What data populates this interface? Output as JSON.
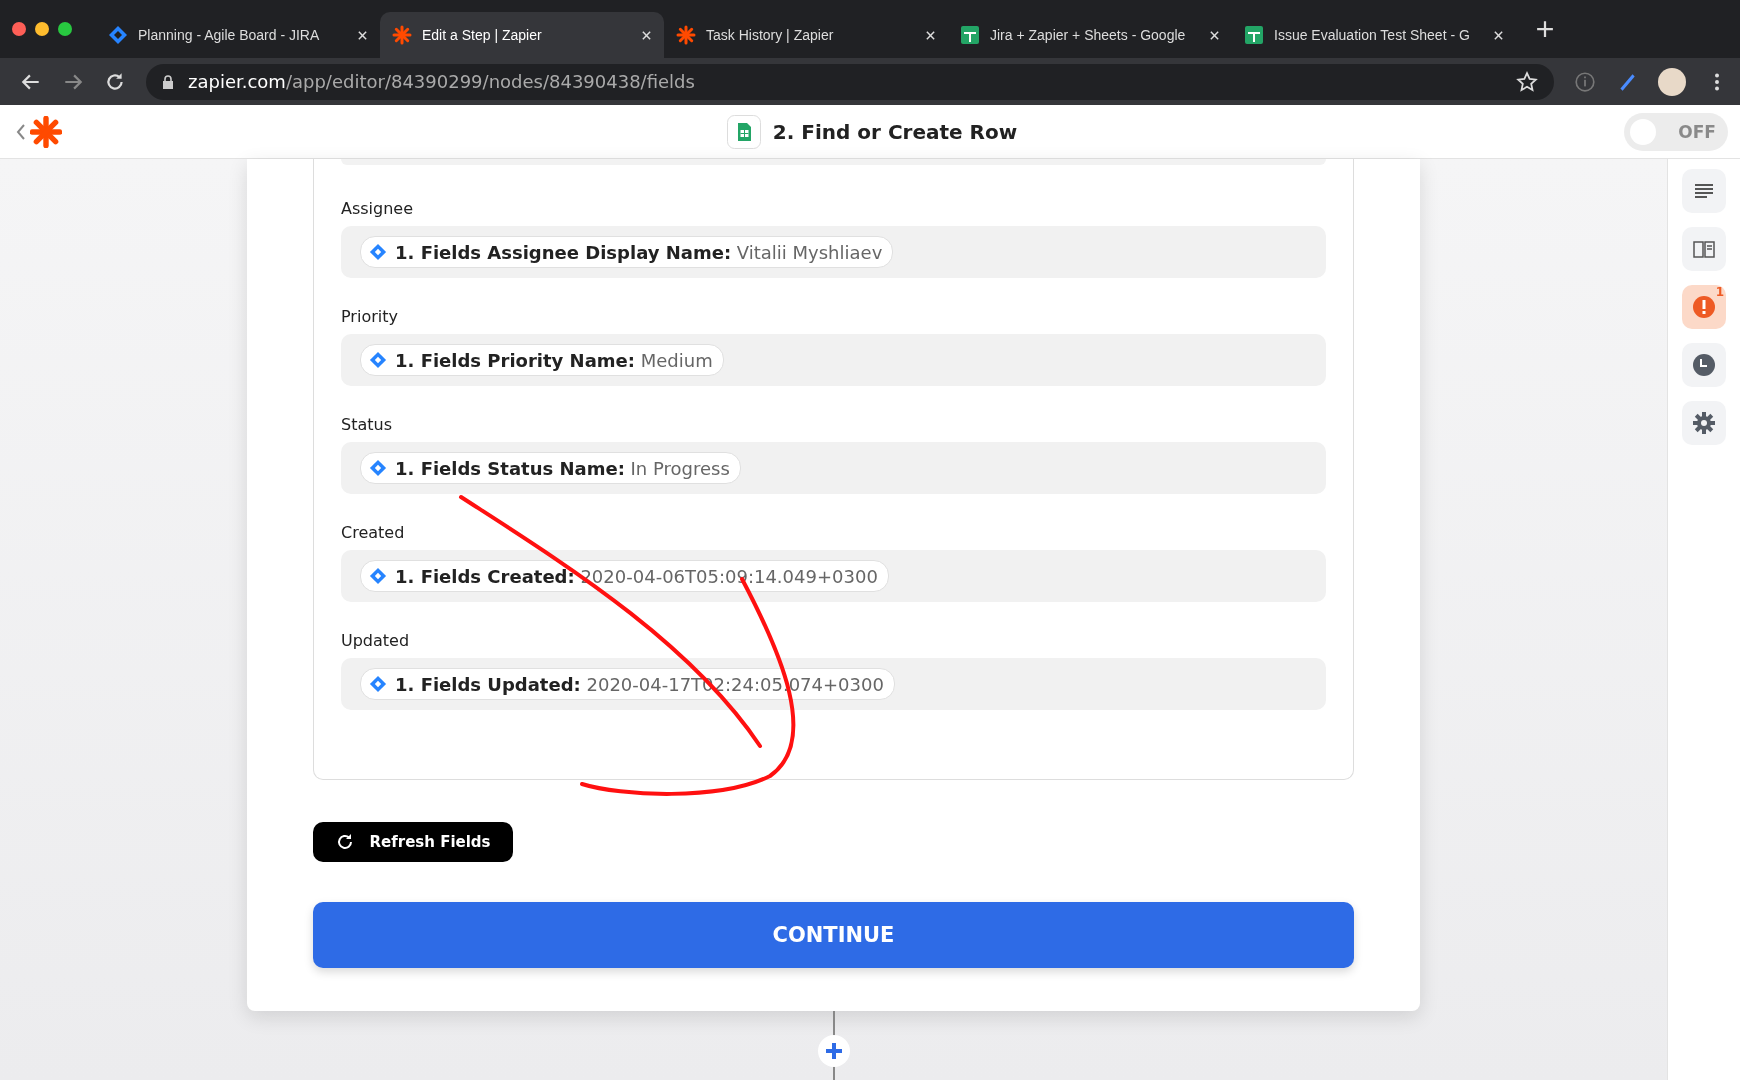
{
  "browser": {
    "tabs": [
      {
        "kind": "jira",
        "title": "Planning - Agile Board - JIRA",
        "selected": false
      },
      {
        "kind": "zapier",
        "title": "Edit a Step | Zapier",
        "selected": true
      },
      {
        "kind": "zapier",
        "title": "Task History | Zapier",
        "selected": false
      },
      {
        "kind": "sheets",
        "title": "Jira + Zapier + Sheets - Google",
        "selected": false
      },
      {
        "kind": "sheets",
        "title": "Issue Evaluation Test Sheet - G",
        "selected": false
      }
    ],
    "url_host": "zapier.com",
    "url_path": "/app/editor/84390299/nodes/84390438/fields"
  },
  "header": {
    "step_title": "2. Find or Create Row",
    "toggle": {
      "on": false,
      "label": "OFF"
    }
  },
  "fields": [
    {
      "label": "Assignee",
      "token": "1. Fields Assignee Display Name:",
      "value": "Vitalii Myshliaev"
    },
    {
      "label": "Priority",
      "token": "1. Fields Priority Name:",
      "value": "Medium"
    },
    {
      "label": "Status",
      "token": "1. Fields Status Name:",
      "value": "In Progress"
    },
    {
      "label": "Created",
      "token": "1. Fields Created:",
      "value": "2020-04-06T05:09:14.049+0300"
    },
    {
      "label": "Updated",
      "token": "1. Fields Updated:",
      "value": "2020-04-17T02:24:05.074+0300"
    }
  ],
  "refresh_button": "Refresh Fields",
  "continue_button": "CONTINUE",
  "sidebar": [
    {
      "kind": "lines",
      "selected": false
    },
    {
      "kind": "book",
      "selected": false
    },
    {
      "kind": "alert",
      "selected": true,
      "badge": "1"
    },
    {
      "kind": "clock",
      "selected": false
    },
    {
      "kind": "gear",
      "selected": false
    }
  ]
}
